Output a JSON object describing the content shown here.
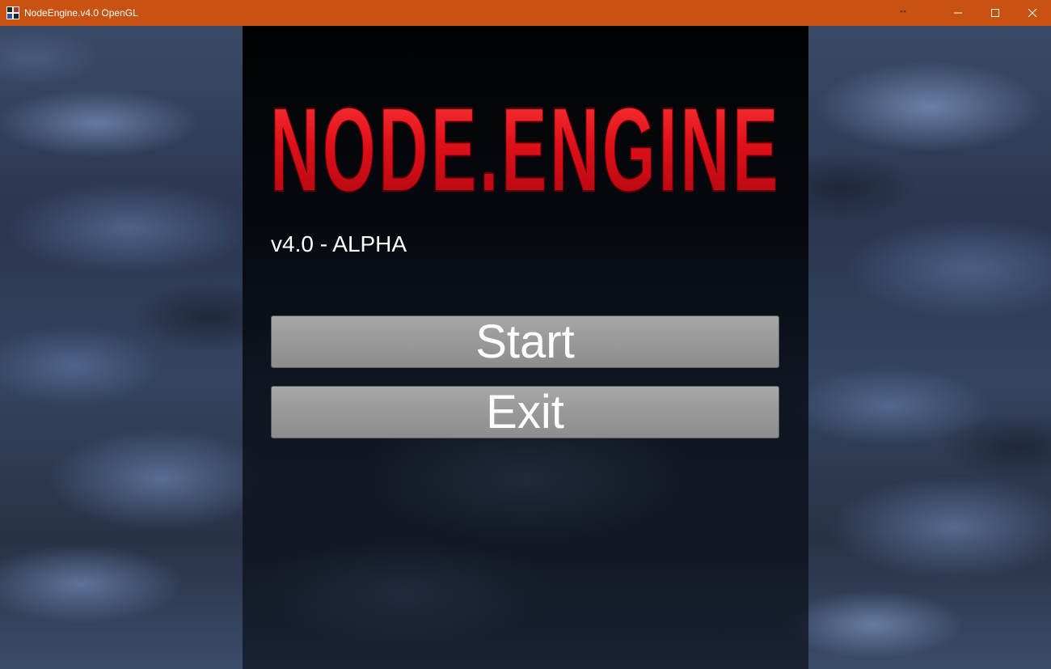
{
  "window": {
    "title": "NodeEngine.v4.0 OpenGL",
    "titlebar_color": "#c75211",
    "resize_glyph": "↔",
    "controls": [
      "minimize-icon",
      "maximize-icon",
      "close-icon"
    ]
  },
  "menu": {
    "logo_text": "NODE.ENGINE",
    "logo_color": "#e0101a",
    "version": "v4.0 - ALPHA",
    "start_label": "Start",
    "exit_label": "Exit"
  }
}
